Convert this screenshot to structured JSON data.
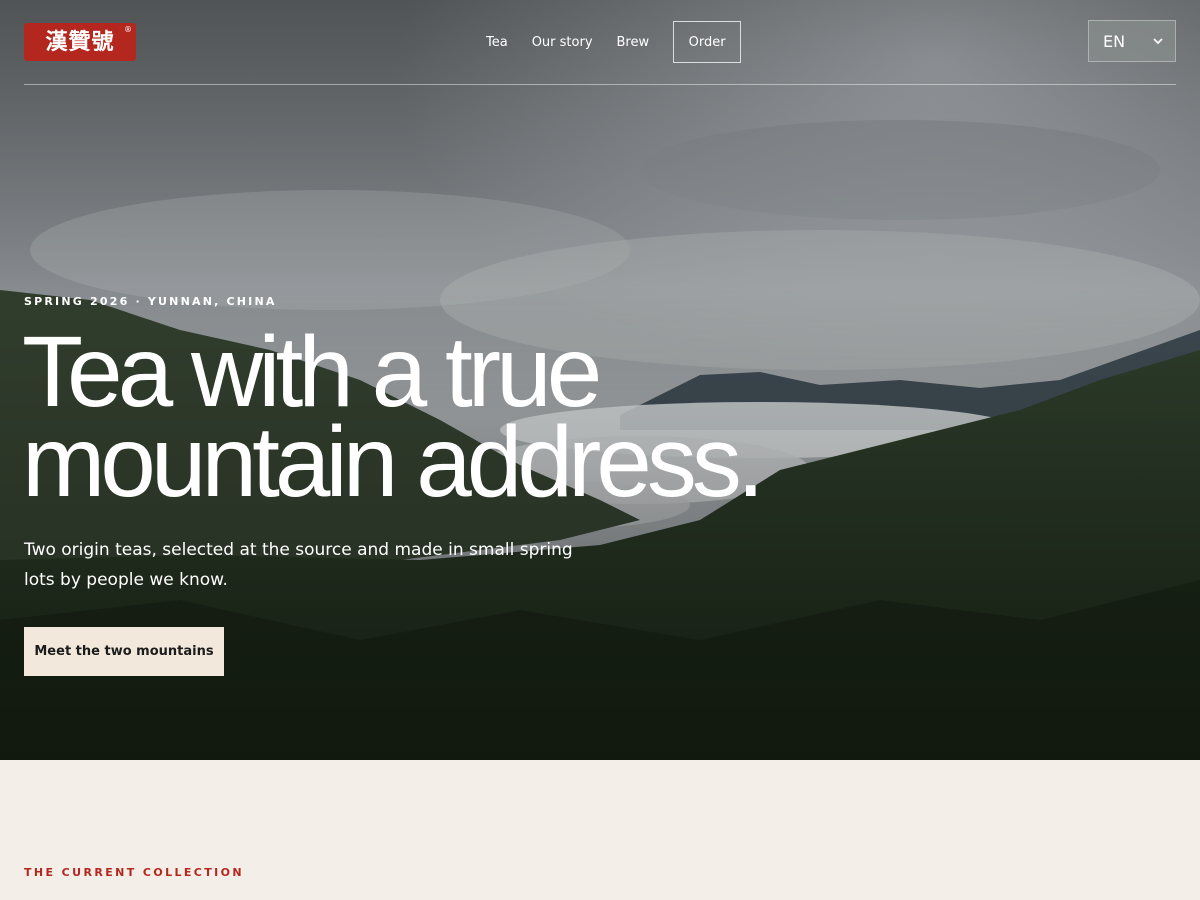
{
  "brand": {
    "logo_text": "漢贊號",
    "registered_mark": "®"
  },
  "nav": {
    "items": [
      {
        "label": "Tea"
      },
      {
        "label": "Our story"
      },
      {
        "label": "Brew"
      }
    ],
    "order_label": "Order"
  },
  "language": {
    "selected": "EN"
  },
  "hero": {
    "eyebrow": "SPRING 2026 · YUNNAN, CHINA",
    "headline_line1": "Tea with a true",
    "headline_line2": "mountain address.",
    "subtitle": "Two origin teas, selected at the source and made in small spring lots by people we know.",
    "cta_label": "Meet the two mountains"
  },
  "collection": {
    "label": "THE CURRENT COLLECTION"
  },
  "colors": {
    "brand_red": "#b3271f",
    "cream": "#f2e9dc",
    "page_bg": "#f3efe8"
  },
  "icons": {
    "language_dropdown": "chevron-down-icon"
  }
}
